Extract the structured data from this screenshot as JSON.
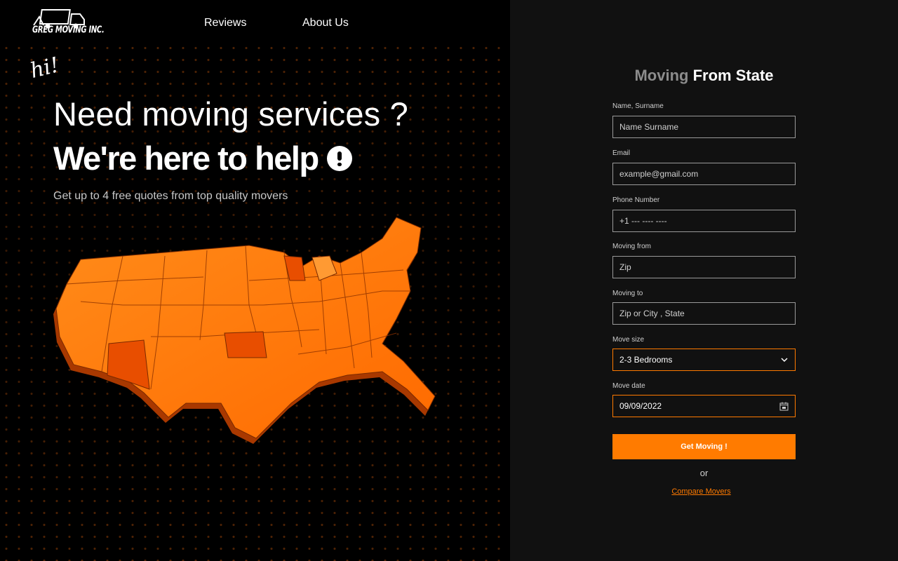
{
  "brand": {
    "logo_text": "GREG MOVING INC."
  },
  "nav": {
    "reviews": "Reviews",
    "about": "About Us"
  },
  "hero": {
    "hi": "hi!",
    "headline_1": "Need moving services ?",
    "headline_2": "We're here to help",
    "subtitle": "Get up to 4 free quotes from top quality movers"
  },
  "form": {
    "title_muted": "Moving",
    "title_strong": "From State",
    "fields": [
      {
        "label": "Name, Surname",
        "placeholder": "Name Surname"
      },
      {
        "label": "Email",
        "placeholder": "example@gmail.com"
      },
      {
        "label": "Phone Number",
        "placeholder": "+1 --- ---- ----"
      },
      {
        "label": "Moving from",
        "placeholder": "Zip"
      },
      {
        "label": "Moving to",
        "placeholder": "Zip or City , State"
      }
    ],
    "move_size": {
      "label": "Move size",
      "value": "2-3 Bedrooms"
    },
    "move_date": {
      "label": "Move date",
      "value": "09/09/2022"
    },
    "submit_label": "Get Moving !",
    "or_text": "or",
    "compare_link": "Compare Movers"
  },
  "colors": {
    "accent": "#ff7b00",
    "panel": "#111111",
    "background": "#000000"
  }
}
